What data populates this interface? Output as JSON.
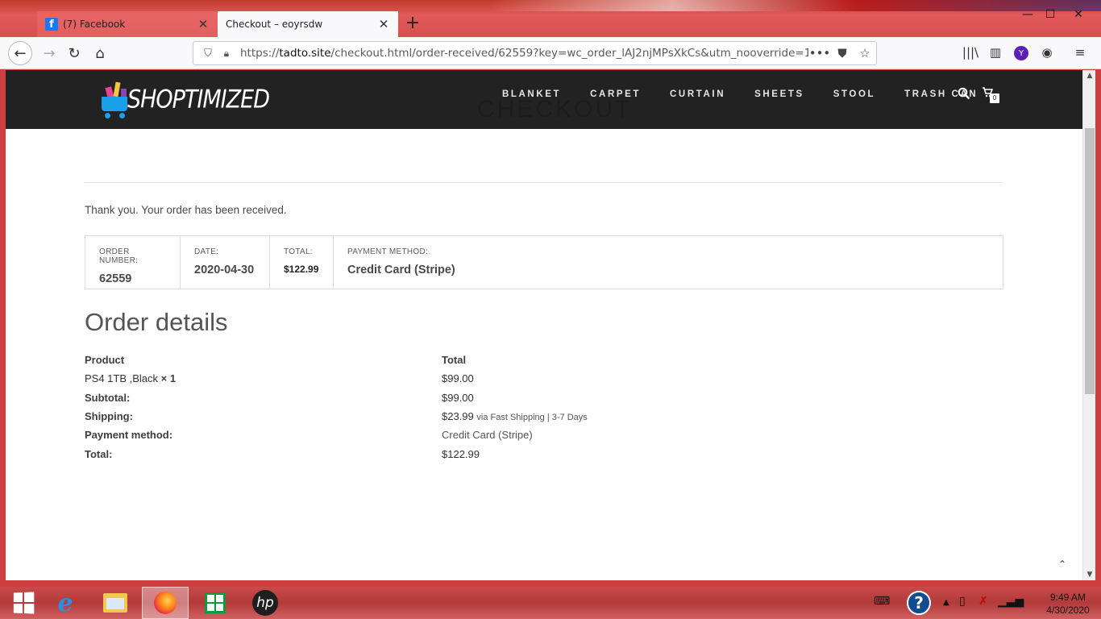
{
  "browser": {
    "tabs": [
      {
        "title": "(7) Facebook",
        "active": false,
        "icon": "facebook-icon"
      },
      {
        "title": "Checkout – eoyrsdw",
        "active": true
      }
    ],
    "url": {
      "scheme": "https://",
      "host": "tadto.site",
      "path": "/checkout.html/order-received/62559?key=wc_order_lAJ2njMPsXkCs&utm_nooverride=1"
    },
    "profile_initial": "Y"
  },
  "site": {
    "logo_text": "SHOPTIMIZED",
    "menu": [
      "BLANKET",
      "CARPET",
      "CURTAIN",
      "SHEETS",
      "STOOL",
      "TRASH CAN"
    ],
    "cart_count": "0",
    "page_title": "CHECKOUT"
  },
  "order": {
    "thank_you": "Thank you. Your order has been received.",
    "overview": [
      {
        "label": "ORDER NUMBER:",
        "value": "62559"
      },
      {
        "label": "DATE:",
        "value": "2020-04-30"
      },
      {
        "label": "TOTAL:",
        "value": "$122.99"
      },
      {
        "label": "PAYMENT METHOD:",
        "value": "Credit Card (Stripe)"
      }
    ],
    "details_title": "Order details",
    "headers": {
      "product": "Product",
      "total": "Total"
    },
    "item": {
      "name": "PS4 1TB ,Black",
      "qty": "× 1",
      "total": "$99.00"
    },
    "subtotal": {
      "label": "Subtotal:",
      "value": "$99.00"
    },
    "shipping": {
      "label": "Shipping:",
      "value": "$23.99",
      "via": "via Fast Shipping | 3-7 Days"
    },
    "payment_method": {
      "label": "Payment method:",
      "value": "Credit Card (Stripe)"
    },
    "total": {
      "label": "Total:",
      "value": "$122.99"
    }
  },
  "taskbar": {
    "time": "9:49 AM",
    "date": "4/30/2020"
  }
}
